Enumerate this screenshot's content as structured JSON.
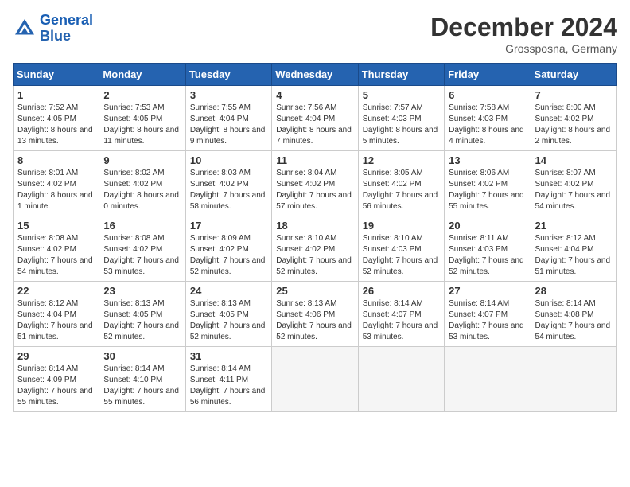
{
  "header": {
    "logo_line1": "General",
    "logo_line2": "Blue",
    "month": "December 2024",
    "location": "Grossposna, Germany"
  },
  "weekdays": [
    "Sunday",
    "Monday",
    "Tuesday",
    "Wednesday",
    "Thursday",
    "Friday",
    "Saturday"
  ],
  "weeks": [
    [
      {
        "day": "1",
        "sunrise": "7:52 AM",
        "sunset": "4:05 PM",
        "daylight": "8 hours and 13 minutes."
      },
      {
        "day": "2",
        "sunrise": "7:53 AM",
        "sunset": "4:05 PM",
        "daylight": "8 hours and 11 minutes."
      },
      {
        "day": "3",
        "sunrise": "7:55 AM",
        "sunset": "4:04 PM",
        "daylight": "8 hours and 9 minutes."
      },
      {
        "day": "4",
        "sunrise": "7:56 AM",
        "sunset": "4:04 PM",
        "daylight": "8 hours and 7 minutes."
      },
      {
        "day": "5",
        "sunrise": "7:57 AM",
        "sunset": "4:03 PM",
        "daylight": "8 hours and 5 minutes."
      },
      {
        "day": "6",
        "sunrise": "7:58 AM",
        "sunset": "4:03 PM",
        "daylight": "8 hours and 4 minutes."
      },
      {
        "day": "7",
        "sunrise": "8:00 AM",
        "sunset": "4:02 PM",
        "daylight": "8 hours and 2 minutes."
      }
    ],
    [
      {
        "day": "8",
        "sunrise": "8:01 AM",
        "sunset": "4:02 PM",
        "daylight": "8 hours and 1 minute."
      },
      {
        "day": "9",
        "sunrise": "8:02 AM",
        "sunset": "4:02 PM",
        "daylight": "8 hours and 0 minutes."
      },
      {
        "day": "10",
        "sunrise": "8:03 AM",
        "sunset": "4:02 PM",
        "daylight": "7 hours and 58 minutes."
      },
      {
        "day": "11",
        "sunrise": "8:04 AM",
        "sunset": "4:02 PM",
        "daylight": "7 hours and 57 minutes."
      },
      {
        "day": "12",
        "sunrise": "8:05 AM",
        "sunset": "4:02 PM",
        "daylight": "7 hours and 56 minutes."
      },
      {
        "day": "13",
        "sunrise": "8:06 AM",
        "sunset": "4:02 PM",
        "daylight": "7 hours and 55 minutes."
      },
      {
        "day": "14",
        "sunrise": "8:07 AM",
        "sunset": "4:02 PM",
        "daylight": "7 hours and 54 minutes."
      }
    ],
    [
      {
        "day": "15",
        "sunrise": "8:08 AM",
        "sunset": "4:02 PM",
        "daylight": "7 hours and 54 minutes."
      },
      {
        "day": "16",
        "sunrise": "8:08 AM",
        "sunset": "4:02 PM",
        "daylight": "7 hours and 53 minutes."
      },
      {
        "day": "17",
        "sunrise": "8:09 AM",
        "sunset": "4:02 PM",
        "daylight": "7 hours and 52 minutes."
      },
      {
        "day": "18",
        "sunrise": "8:10 AM",
        "sunset": "4:02 PM",
        "daylight": "7 hours and 52 minutes."
      },
      {
        "day": "19",
        "sunrise": "8:10 AM",
        "sunset": "4:03 PM",
        "daylight": "7 hours and 52 minutes."
      },
      {
        "day": "20",
        "sunrise": "8:11 AM",
        "sunset": "4:03 PM",
        "daylight": "7 hours and 52 minutes."
      },
      {
        "day": "21",
        "sunrise": "8:12 AM",
        "sunset": "4:04 PM",
        "daylight": "7 hours and 51 minutes."
      }
    ],
    [
      {
        "day": "22",
        "sunrise": "8:12 AM",
        "sunset": "4:04 PM",
        "daylight": "7 hours and 51 minutes."
      },
      {
        "day": "23",
        "sunrise": "8:13 AM",
        "sunset": "4:05 PM",
        "daylight": "7 hours and 52 minutes."
      },
      {
        "day": "24",
        "sunrise": "8:13 AM",
        "sunset": "4:05 PM",
        "daylight": "7 hours and 52 minutes."
      },
      {
        "day": "25",
        "sunrise": "8:13 AM",
        "sunset": "4:06 PM",
        "daylight": "7 hours and 52 minutes."
      },
      {
        "day": "26",
        "sunrise": "8:14 AM",
        "sunset": "4:07 PM",
        "daylight": "7 hours and 53 minutes."
      },
      {
        "day": "27",
        "sunrise": "8:14 AM",
        "sunset": "4:07 PM",
        "daylight": "7 hours and 53 minutes."
      },
      {
        "day": "28",
        "sunrise": "8:14 AM",
        "sunset": "4:08 PM",
        "daylight": "7 hours and 54 minutes."
      }
    ],
    [
      {
        "day": "29",
        "sunrise": "8:14 AM",
        "sunset": "4:09 PM",
        "daylight": "7 hours and 55 minutes."
      },
      {
        "day": "30",
        "sunrise": "8:14 AM",
        "sunset": "4:10 PM",
        "daylight": "7 hours and 55 minutes."
      },
      {
        "day": "31",
        "sunrise": "8:14 AM",
        "sunset": "4:11 PM",
        "daylight": "7 hours and 56 minutes."
      },
      null,
      null,
      null,
      null
    ]
  ]
}
